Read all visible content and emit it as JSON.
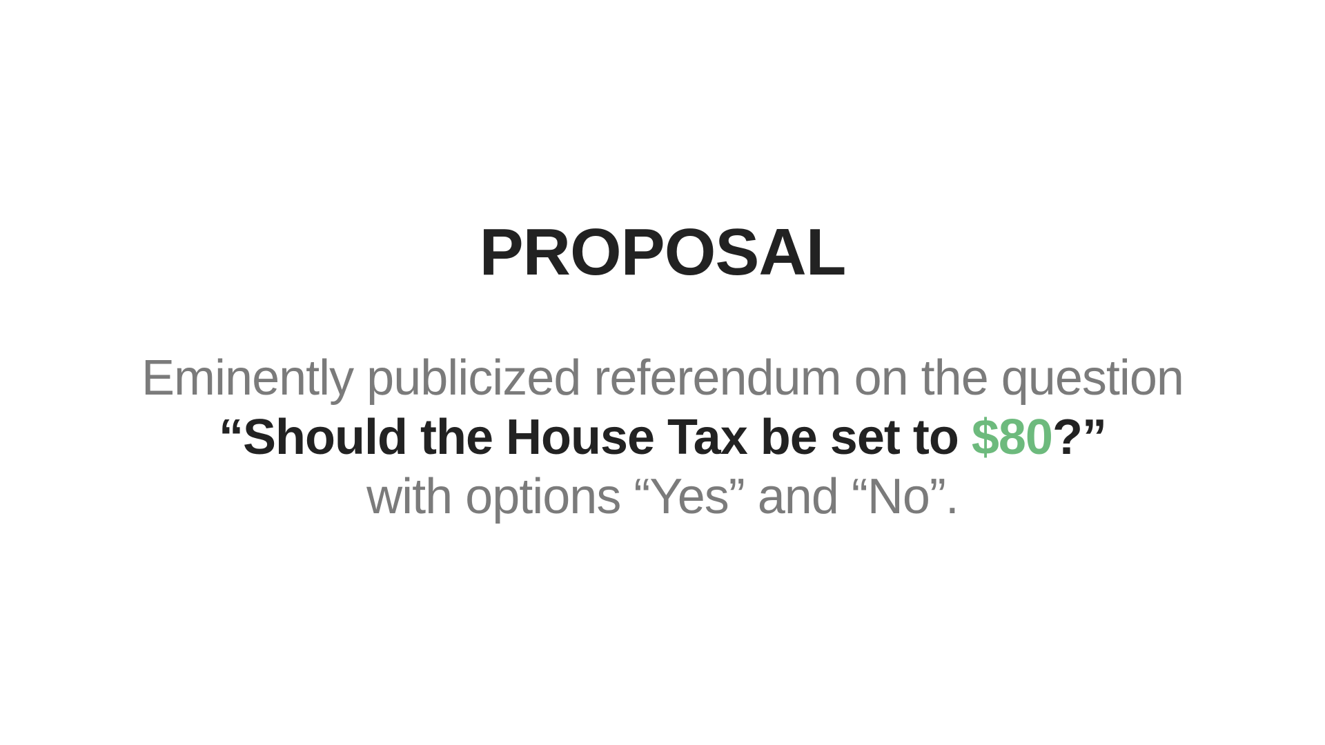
{
  "slide": {
    "title": "PROPOSAL",
    "intro": "Eminently publicized referendum on the question",
    "question_before": "“Should the House Tax be set to ",
    "question_amount": "$80",
    "question_after": "?”",
    "options_text": "with options “Yes” and “No”."
  },
  "colors": {
    "title": "#222222",
    "body": "#7b7b7b",
    "amount_accent": "#6dba7d",
    "background": "#ffffff"
  }
}
